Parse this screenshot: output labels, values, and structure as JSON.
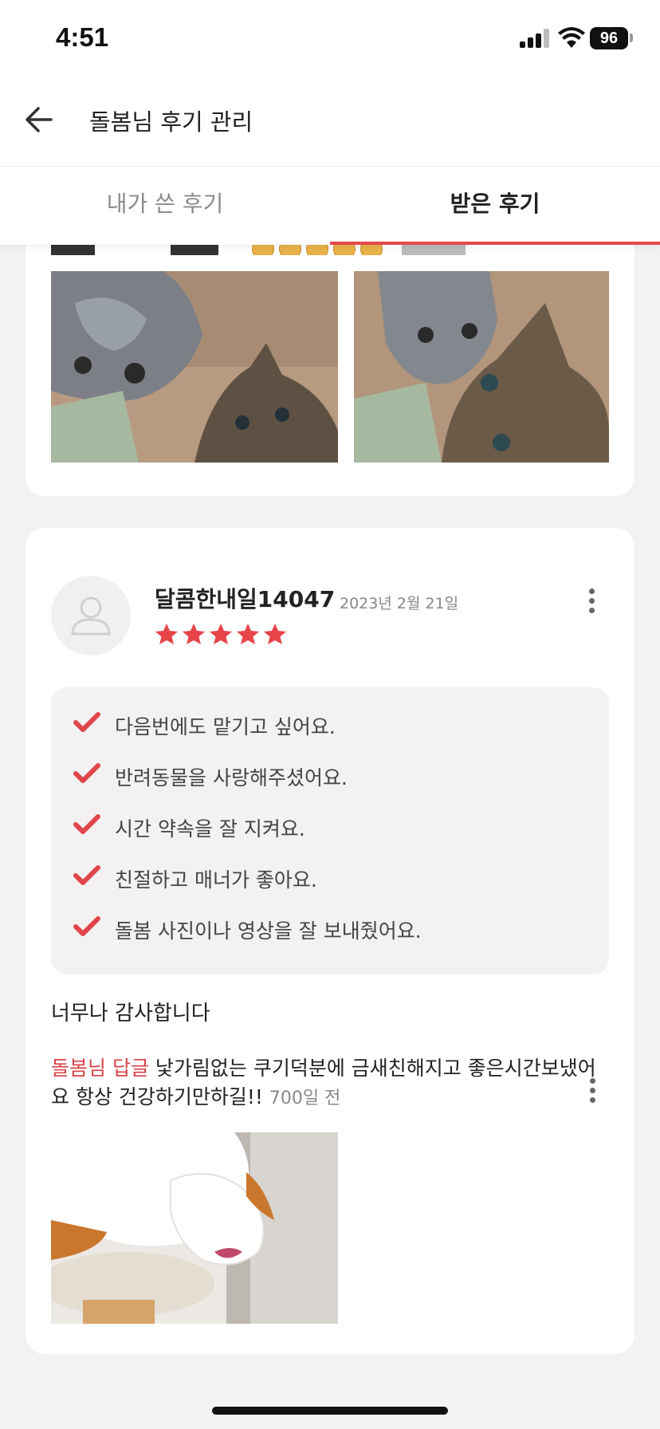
{
  "status_bar": {
    "time": "4:51",
    "battery": "96"
  },
  "header": {
    "title": "돌봄님 후기 관리"
  },
  "tabs": [
    {
      "label": "내가 쓴 후기",
      "active": false
    },
    {
      "label": "받은 후기",
      "active": true
    }
  ],
  "review": {
    "author": "달콤한내일14047",
    "date": "2023년 2월 21일",
    "rating": 5,
    "checklist": [
      "다음번에도 맡기고 싶어요.",
      "반려동물을 사랑해주셨어요.",
      "시간 약속을 잘 지켜요.",
      "친절하고 매너가 좋아요.",
      "돌봄 사진이나 영상을 잘 보내줬어요."
    ],
    "comment": "너무나 감사합니다",
    "reply": {
      "label": "돌봄님 답글",
      "text": " 낯가림없는 쿠기덕분에 금새친해지고 좋은시간보냈어요 항상 건강하기만하길!!",
      "ago": "700일 전"
    }
  },
  "colors": {
    "accent": "#e5484d",
    "star": "#e8454b",
    "check": "#e0454a"
  }
}
